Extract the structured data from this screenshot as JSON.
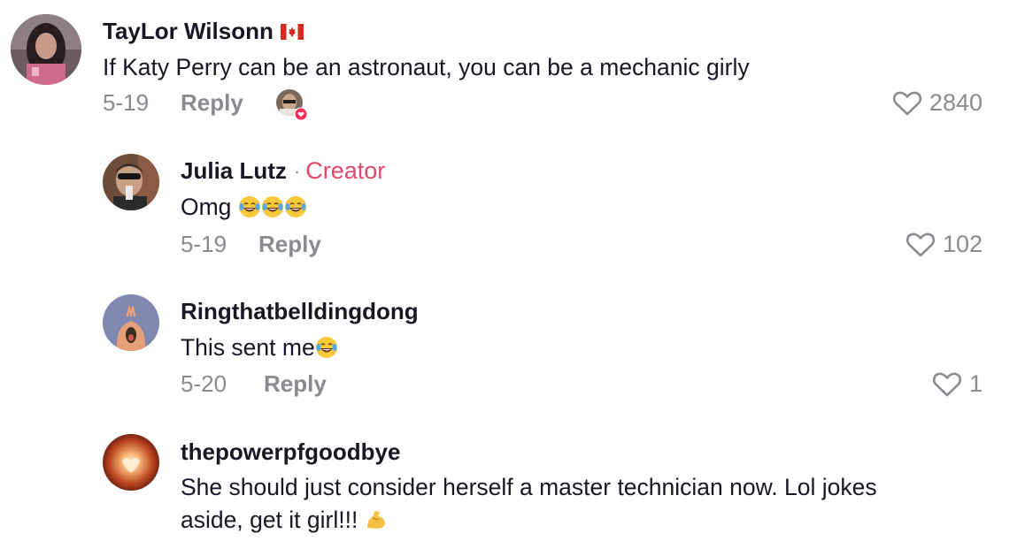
{
  "comments": [
    {
      "username": "TayLor Wilsonn",
      "flag_icon": "canada-flag-icon",
      "text": "If Katy Perry can be an astronaut, you can be a mechanic girly",
      "date": "5-19",
      "reply_label": "Reply",
      "likes": "2840",
      "liked_by_creator": true
    },
    {
      "username": "Julia Lutz",
      "creator_sep": "·",
      "creator_badge": "Creator",
      "text": "Omg",
      "emoji": [
        "laughing-tears-emoji",
        "laughing-tears-emoji",
        "laughing-tears-emoji"
      ],
      "date": "5-19",
      "reply_label": "Reply",
      "likes": "102"
    },
    {
      "username": "Ringthatbelldingdong",
      "text": "This sent me",
      "emoji": [
        "laughing-tears-emoji"
      ],
      "date": "5-20",
      "reply_label": "Reply",
      "likes": "1"
    },
    {
      "username": "thepowerpfgoodbye",
      "text_line1": "She should just consider herself a master technician now. Lol jokes",
      "text_line2": "aside, get it girl!!!",
      "emoji": [
        "flexed-biceps-emoji"
      ]
    }
  ],
  "colors": {
    "text": "#161823",
    "muted": "#8a8b91",
    "creator": "#e0486c",
    "heart_badge": "#fe2c55"
  }
}
